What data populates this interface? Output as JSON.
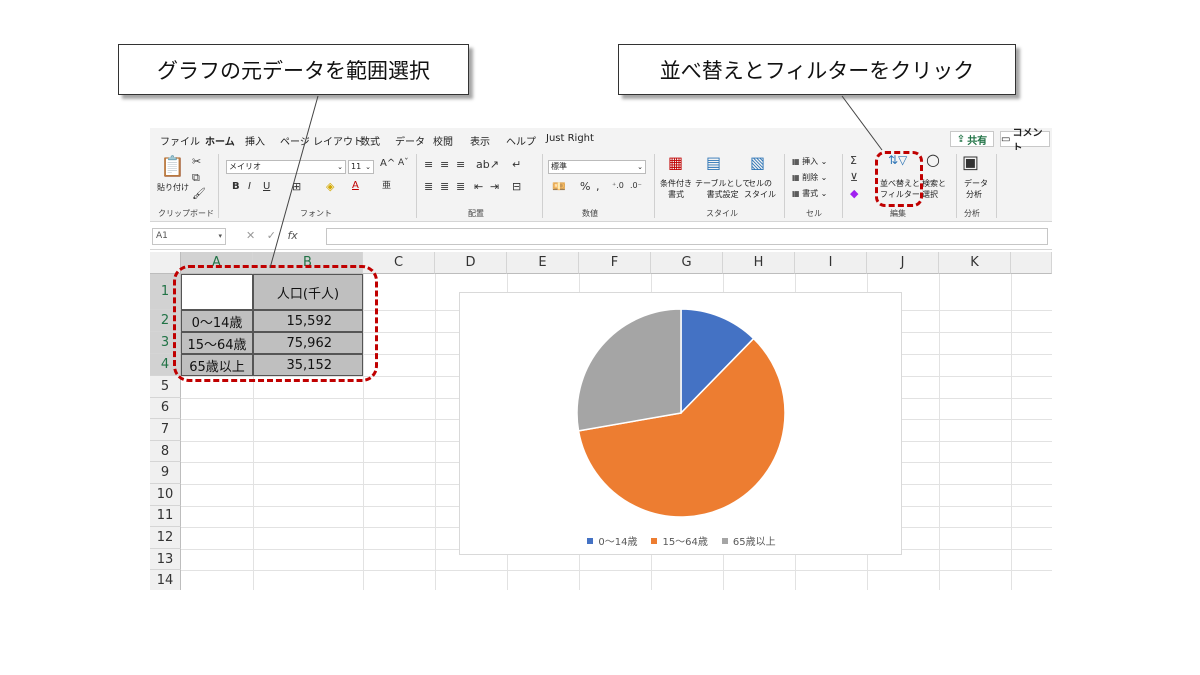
{
  "callouts": {
    "left": "グラフの元データを範囲選択",
    "right": "並べ替えとフィルターをクリック"
  },
  "tabs": [
    "ファイル",
    "ホーム",
    "挿入",
    "ページ レイアウト",
    "数式",
    "データ",
    "校閲",
    "表示",
    "ヘルプ",
    "Just Right"
  ],
  "active_tab": "ホーム",
  "share_label": "共有",
  "comment_label": "コメント",
  "ribbon": {
    "clipboard": {
      "paste": "貼り付け",
      "group": "クリップボード"
    },
    "font": {
      "name": "メイリオ",
      "size": "11",
      "bold": "B",
      "italic": "I",
      "underline": "U",
      "grow": "A",
      "shrink": "A",
      "color": "A",
      "group": "フォント"
    },
    "alignment": {
      "group": "配置"
    },
    "number": {
      "format": "標準",
      "percent": "%",
      "group": "数値"
    },
    "styles": {
      "conditional": "条件付き\n書式",
      "table": "テーブルとして\n書式設定",
      "cell": "セルの\nスタイル",
      "group": "スタイル"
    },
    "cells": {
      "insert": "挿入",
      "delete": "削除",
      "format": "書式",
      "group": "セル"
    },
    "editing": {
      "sum": "Σ",
      "sort_filter_1": "並べ替えと",
      "sort_filter_2": "フィルター",
      "find_1": "検索と",
      "find_2": "選択",
      "group": "編集"
    },
    "analysis": {
      "data_analysis_1": "データ",
      "data_analysis_2": "分析",
      "group": "分析"
    }
  },
  "formula_bar": {
    "name_box": "A1",
    "fx": "fx"
  },
  "columns": [
    "A",
    "B",
    "C",
    "D",
    "E",
    "F",
    "G",
    "H",
    "I",
    "J",
    "K"
  ],
  "rows": [
    "1",
    "2",
    "3",
    "4",
    "5",
    "6",
    "7",
    "8",
    "9",
    "10",
    "11",
    "12",
    "13",
    "14"
  ],
  "table": {
    "header": "人口(千人)",
    "rows": [
      {
        "label": "0～14歳",
        "value": "15,592"
      },
      {
        "label": "15～64歳",
        "value": "75,962"
      },
      {
        "label": "65歳以上",
        "value": "35,152"
      }
    ]
  },
  "chart_data": {
    "type": "pie",
    "categories": [
      "0～14歳",
      "15～64歳",
      "65歳以上"
    ],
    "values": [
      15592,
      75962,
      35152
    ],
    "colors": [
      "#4472c4",
      "#ed7d31",
      "#a5a5a5"
    ],
    "title": "",
    "legend_position": "bottom"
  }
}
